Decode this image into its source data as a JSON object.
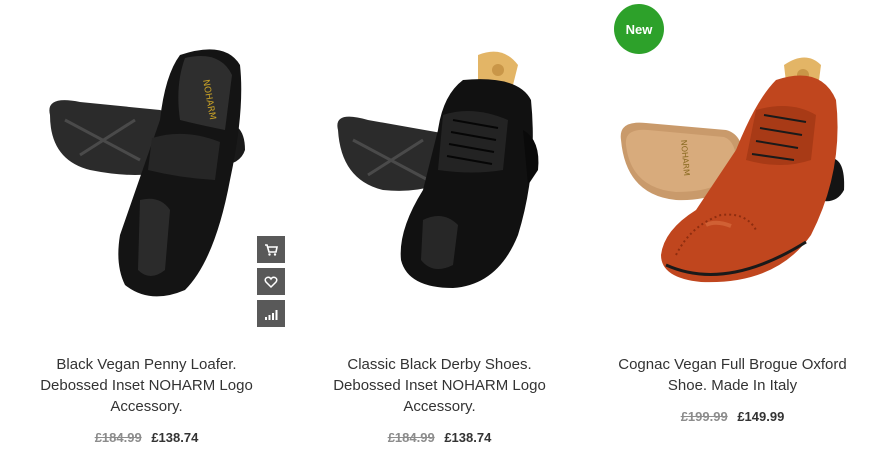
{
  "products": [
    {
      "title_line1": "Black Vegan Penny Loafer.",
      "title_line2": "Debossed Inset NOHARM Logo",
      "title_line3": "Accessory.",
      "old_price": "£184.99",
      "price": "£138.74",
      "sole_brand": "NOHARM"
    },
    {
      "title_line1": "Classic Black Derby Shoes.",
      "title_line2": "Debossed Inset NOHARM Logo",
      "title_line3": "Accessory.",
      "old_price": "£184.99",
      "price": "£138.74"
    },
    {
      "badge": "New",
      "title_line1": "Cognac Vegan Full Brogue Oxford",
      "title_line2": "Shoe. Made In Italy",
      "old_price": "£199.99",
      "price": "£149.99",
      "sole_brand": "NOHARM"
    }
  ],
  "actions": {
    "cart_icon": "cart-icon",
    "wishlist_icon": "heart-icon",
    "compare_icon": "compare-icon"
  },
  "colors": {
    "badge_green": "#2da12a",
    "action_bg": "#595959",
    "title_text": "#333333",
    "old_price": "#8c8c8c"
  }
}
